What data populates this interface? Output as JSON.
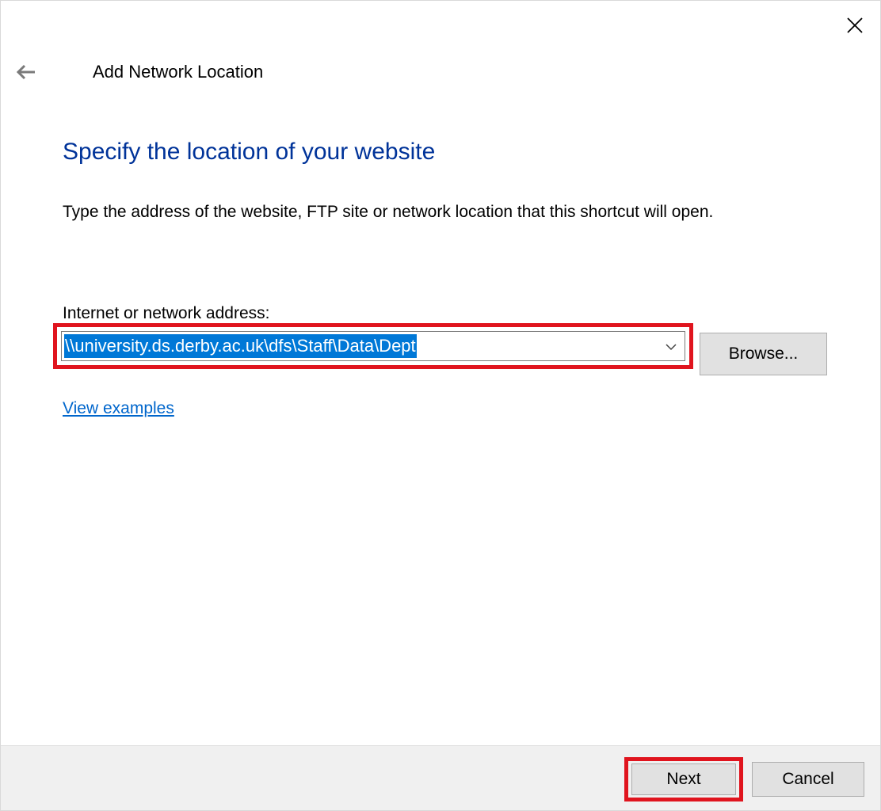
{
  "window": {
    "title": "Add Network Location",
    "close_icon": "close-icon",
    "back_icon": "back-arrow-icon"
  },
  "main": {
    "heading": "Specify the location of your website",
    "description": "Type the address of the website, FTP site or network location that this shortcut will open.",
    "address_label": "Internet or network address:",
    "address_value": "\\\\university.ds.derby.ac.uk\\dfs\\Staff\\Data\\Dept",
    "browse_label": "Browse...",
    "view_examples_label": "View examples"
  },
  "footer": {
    "next_label": "Next",
    "cancel_label": "Cancel"
  },
  "colors": {
    "heading": "#003399",
    "link": "#0066cc",
    "selection": "#0078d7",
    "highlight_box": "#e0141e"
  }
}
